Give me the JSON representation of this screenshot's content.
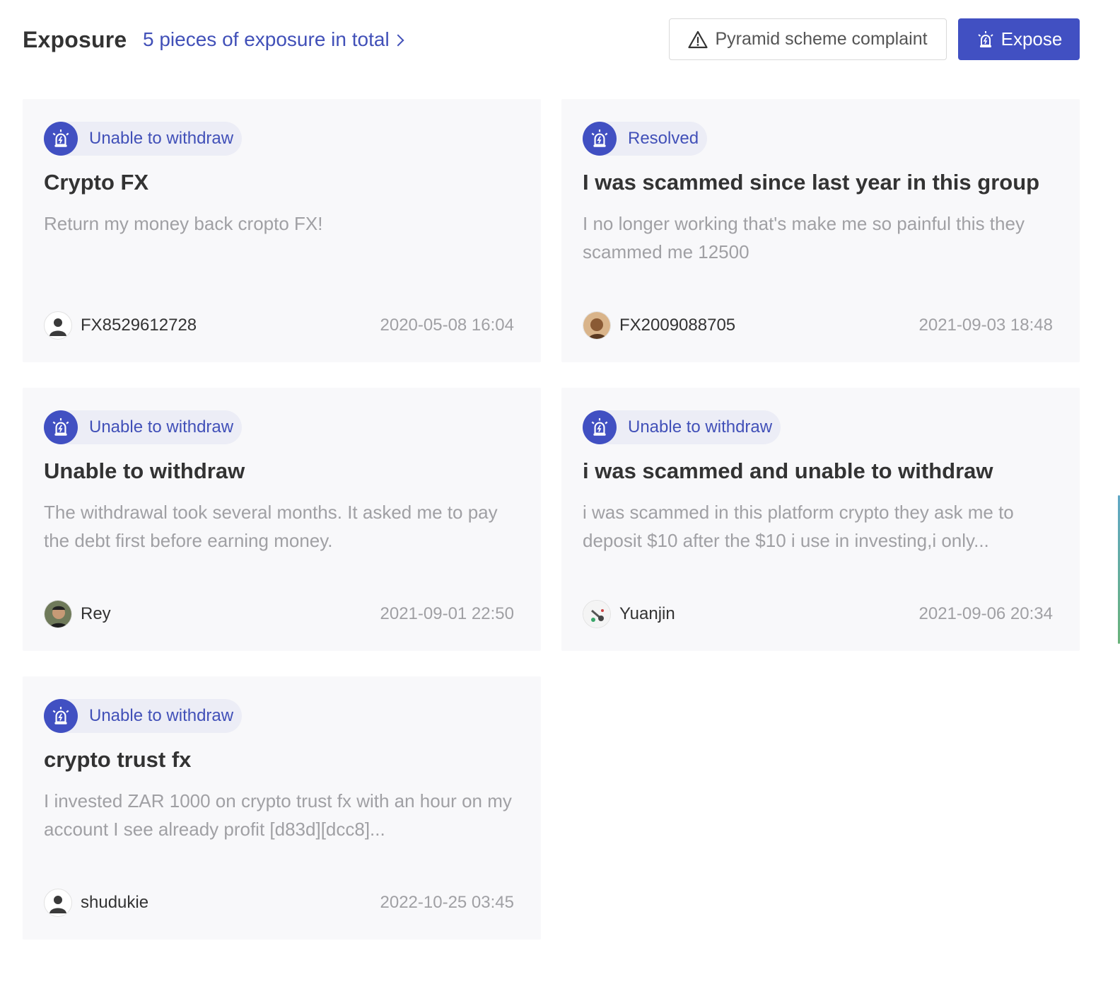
{
  "header": {
    "title": "Exposure",
    "total_link": "5 pieces of exposure in total",
    "complaint_button": "Pyramid scheme complaint",
    "expose_button": "Expose"
  },
  "colors": {
    "accent": "#4150c2",
    "tag_bg": "#ecedf6",
    "card_bg": "#f8f8fa",
    "muted_text": "#a0a0a4"
  },
  "cards": [
    {
      "tag": "Unable to withdraw",
      "title": "Crypto FX",
      "description": "Return my money back cropto FX!",
      "user": "FX8529612728",
      "date": "2020-05-08 16:04",
      "avatar": "default-user-avatar"
    },
    {
      "tag": "Resolved",
      "title": "I was scammed since last year in this group",
      "description": "I no longer working that's make me so painful this they scammed me 12500",
      "user": "FX2009088705",
      "date": "2021-09-03 18:48",
      "avatar": "photo-avatar"
    },
    {
      "tag": "Unable to withdraw",
      "title": "Unable to withdraw",
      "description": "The withdrawal took several months. It asked me to pay the debt first before earning money.",
      "user": "Rey",
      "date": "2021-09-01 22:50",
      "avatar": "photo-avatar"
    },
    {
      "tag": "Unable to withdraw",
      "title": "i was scammed and unable to withdraw",
      "description": "i was scammed in this platform crypto they ask me to deposit $10 after the $10 i use in investing,i only...",
      "user": "Yuanjin",
      "date": "2021-09-06 20:34",
      "avatar": "photo-avatar"
    },
    {
      "tag": "Unable to withdraw",
      "title": "crypto trust fx",
      "description": "I invested ZAR 1000 on crypto trust fx with an hour on my account I see already profit [d83d][dcc8]...",
      "user": "shudukie",
      "date": "2022-10-25 03:45",
      "avatar": "default-user-avatar"
    }
  ]
}
